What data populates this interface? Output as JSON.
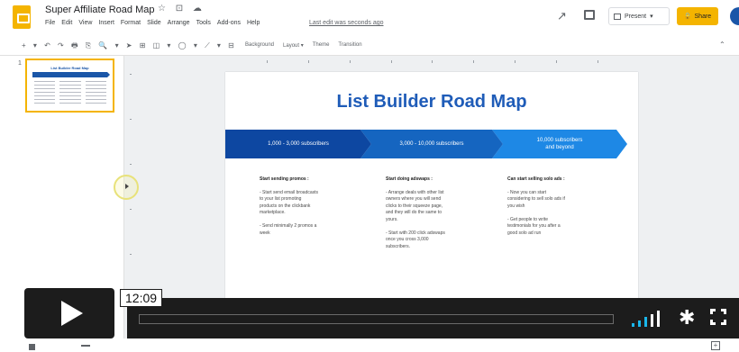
{
  "app": {
    "doc_title": "Super Affiliate Road Map",
    "title_icons": "☆ ⊡ ☁",
    "menu": [
      "File",
      "Edit",
      "View",
      "Insert",
      "Format",
      "Slide",
      "Arrange",
      "Tools",
      "Add-ons",
      "Help"
    ],
    "last_edit": "Last edit was seconds ago",
    "present_label": "Present",
    "present_caret": "▾",
    "share_label": "Share",
    "share_icon": "🔒"
  },
  "toolbar": {
    "icons": "+ ▾ ↶ ↷ 🖶 ⎘   🔍 ▾   ➤ ⊞ ◫ ▾ ◯ ▾ ⟋ ▾   ⊟",
    "background_label": "Background",
    "layout_label": "Layout ▾",
    "theme_label": "Theme",
    "transition_label": "Transition",
    "collapse_icon": "⌃"
  },
  "filmstrip": {
    "slide_number": "1",
    "thumb_title": "List Builder Road Map"
  },
  "slide": {
    "title": "List Builder Road Map",
    "bands": [
      "1,000 - 3,000 subscribers",
      "3,000 - 10,000 subscribers",
      "10,000 subscribers\nand beyond"
    ],
    "columns": [
      {
        "heading": "Start sending promos :",
        "body": "- Start send email broadcasts\nto your list promoting\nproducts on the clickbank\nmarketplace.\n\n- Send minimally 2 promos a\nweek"
      },
      {
        "heading": "Start doing adswaps :",
        "body": "- Arrange deals with other list\nowners where you will send\nclicks to their squeeze page,\nand they will do the same to\nyours.\n\n- Start with 200 click adswaps\nonce you cross 3,000\nsubscribers."
      },
      {
        "heading": "Can start selling solo ads :",
        "body": "- Now you can start\nconsidering to sell solo ads if\nyou wish\n\n- Get people to write\ntestimonials for you after a\ngood solo ad run"
      }
    ]
  },
  "player": {
    "timestamp": "12:09",
    "progress": 0.0,
    "volume_bars": 5,
    "volume_active_bars": 3,
    "icons": {
      "play": "play-icon",
      "volume": "volume-icon",
      "settings": "gear-icon",
      "fullscreen": "fullscreen-icon"
    },
    "settings_glyph": "✱",
    "colors": {
      "bar_background": "#1c1c1c",
      "volume_active": "#1ab7ea",
      "volume_inactive": "#ffffff"
    }
  },
  "colors": {
    "brand_yellow": "#f4b400",
    "slide_title_blue": "#1f5cb8",
    "band_1": "#0d47a1",
    "band_2": "#1565c0",
    "band_3": "#1e88e5"
  }
}
